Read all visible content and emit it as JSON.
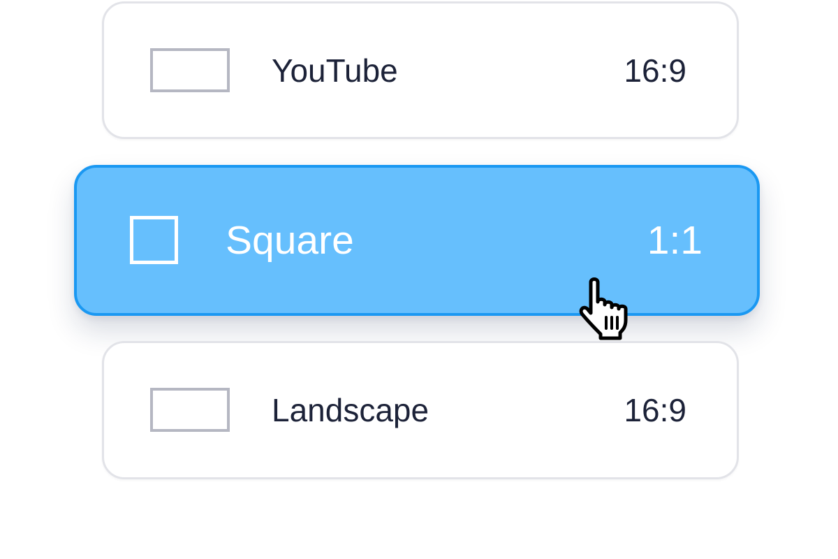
{
  "options": [
    {
      "label": "YouTube",
      "ratio": "16:9",
      "icon": "landscape-ratio-icon",
      "selected": false
    },
    {
      "label": "Square",
      "ratio": "1:1",
      "icon": "square-ratio-icon",
      "selected": true
    },
    {
      "label": "Landscape",
      "ratio": "16:9",
      "icon": "landscape-ratio-icon",
      "selected": false
    }
  ],
  "cursor": {
    "icon": "hand-pointer-icon"
  },
  "colors": {
    "selected_fill": "#66bffd",
    "selected_border": "#1a98f2",
    "card_border": "#e2e3e8",
    "text": "#1c2238",
    "icon_outline": "#b5b7c2"
  }
}
